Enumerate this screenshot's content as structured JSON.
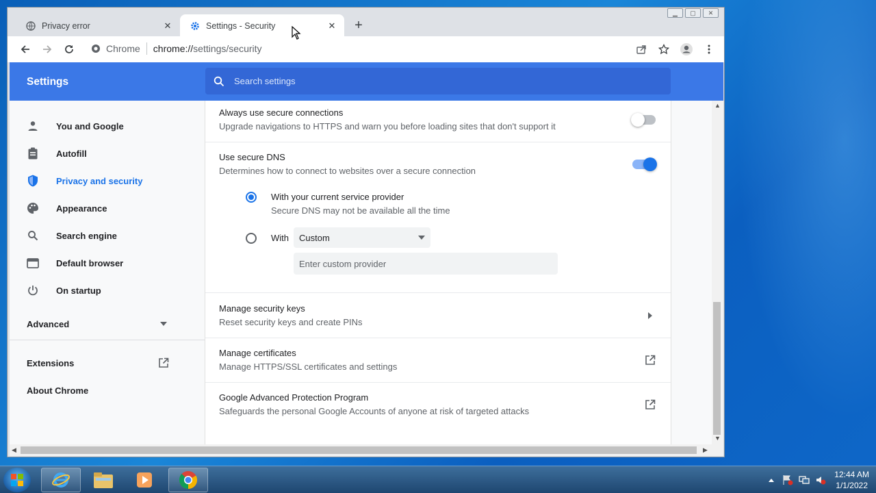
{
  "browser": {
    "tabs": [
      {
        "title": "Privacy error",
        "icon": "globe-icon",
        "active": false
      },
      {
        "title": "Settings - Security",
        "icon": "gear-icon",
        "active": true
      }
    ],
    "new_tab_label": "+",
    "omnibox": {
      "chip": "Chrome",
      "url_host": "chrome://",
      "url_path": "settings/security"
    }
  },
  "settings": {
    "title": "Settings",
    "search_placeholder": "Search settings",
    "nav": [
      {
        "label": "You and Google",
        "icon": "person-icon",
        "active": false
      },
      {
        "label": "Autofill",
        "icon": "clipboard-icon",
        "active": false
      },
      {
        "label": "Privacy and security",
        "icon": "shield-icon",
        "active": true
      },
      {
        "label": "Appearance",
        "icon": "palette-icon",
        "active": false
      },
      {
        "label": "Search engine",
        "icon": "search-icon",
        "active": false
      },
      {
        "label": "Default browser",
        "icon": "browser-icon",
        "active": false
      },
      {
        "label": "On startup",
        "icon": "power-icon",
        "active": false
      }
    ],
    "advanced_label": "Advanced",
    "extensions_label": "Extensions",
    "about_label": "About Chrome"
  },
  "content": {
    "secure_connections": {
      "title": "Always use secure connections",
      "subtitle": "Upgrade navigations to HTTPS and warn you before loading sites that don't support it",
      "enabled": false
    },
    "secure_dns": {
      "title": "Use secure DNS",
      "subtitle": "Determines how to connect to websites over a secure connection",
      "enabled": true,
      "option_current": {
        "title": "With your current service provider",
        "subtitle": "Secure DNS may not be available all the time",
        "checked": true
      },
      "option_with": {
        "label": "With",
        "checked": false
      },
      "provider_selected": "Custom",
      "custom_placeholder": "Enter custom provider"
    },
    "security_keys": {
      "title": "Manage security keys",
      "subtitle": "Reset security keys and create PINs"
    },
    "certificates": {
      "title": "Manage certificates",
      "subtitle": "Manage HTTPS/SSL certificates and settings"
    },
    "advanced_protection": {
      "title": "Google Advanced Protection Program",
      "subtitle": "Safeguards the personal Google Accounts of anyone at risk of targeted attacks"
    }
  },
  "taskbar": {
    "apps": [
      "internet-explorer-icon",
      "file-explorer-icon",
      "media-player-icon",
      "chrome-icon"
    ],
    "time": "12:44 AM",
    "date": "1/1/2022"
  },
  "colors": {
    "accent": "#1a73e8",
    "header": "#3b78e7",
    "search_bg": "#3367d6"
  }
}
